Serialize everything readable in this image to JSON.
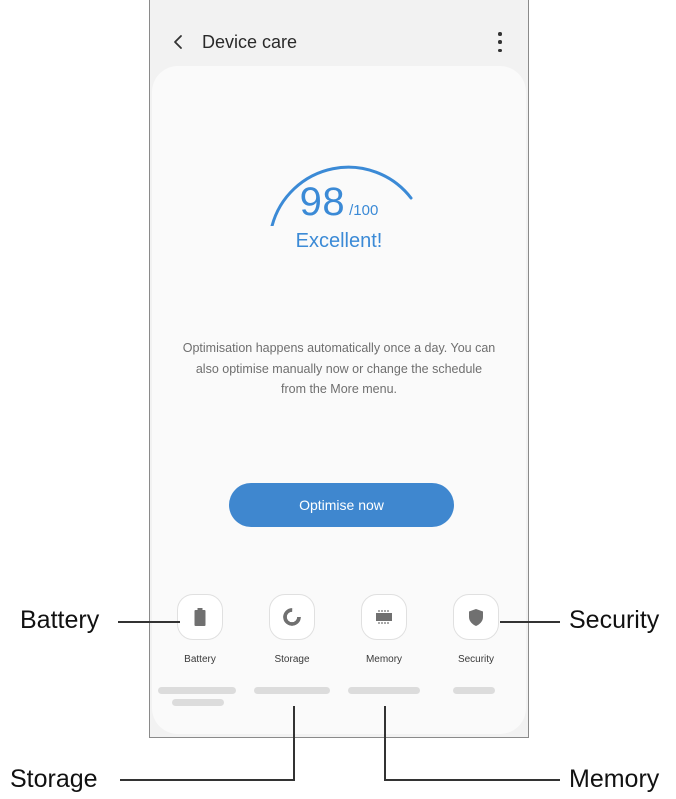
{
  "app_bar": {
    "title": "Device care"
  },
  "score": {
    "value": "98",
    "max": "/100",
    "status": "Excellent!",
    "fraction": 0.98
  },
  "description": "Optimisation happens automatically once a day. You can also optimise manually now or change the schedule from the More menu.",
  "optimise_button": "Optimise now",
  "tiles": [
    {
      "label": "Battery",
      "icon": "battery-icon"
    },
    {
      "label": "Storage",
      "icon": "storage-icon"
    },
    {
      "label": "Memory",
      "icon": "memory-icon"
    },
    {
      "label": "Security",
      "icon": "security-icon"
    }
  ],
  "callouts": {
    "battery": "Battery",
    "security": "Security",
    "storage": "Storage",
    "memory": "Memory"
  },
  "colors": {
    "accent": "#3f87cf",
    "score_text": "#3b8ad6",
    "background": "#f2f2f2"
  }
}
